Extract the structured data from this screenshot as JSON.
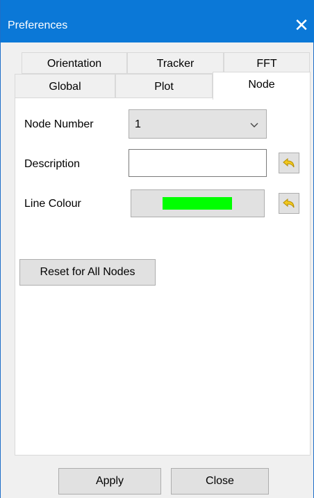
{
  "window": {
    "title": "Preferences",
    "close_glyph": "✕"
  },
  "tabs": {
    "row1": [
      {
        "label": "Orientation"
      },
      {
        "label": "Tracker"
      },
      {
        "label": "FFT"
      }
    ],
    "row2": [
      {
        "label": "Global"
      },
      {
        "label": "Plot"
      },
      {
        "label": "Node",
        "selected": true
      }
    ]
  },
  "node_panel": {
    "node_number": {
      "label": "Node Number",
      "value": "1"
    },
    "description": {
      "label": "Description",
      "value": ""
    },
    "line_colour": {
      "label": "Line Colour",
      "color": "#00ff00"
    },
    "reset_button": "Reset for All Nodes"
  },
  "footer": {
    "apply_label": "Apply",
    "close_label": "Close"
  },
  "icons": {
    "combo_arrow": "chevron-down-icon",
    "undo": "undo-arrow-icon"
  },
  "colors": {
    "titlebar": "#0b78d7",
    "window_bg": "#f0f0f0",
    "button_face": "#e1e1e1",
    "undo_icon": "#f2c81f"
  }
}
